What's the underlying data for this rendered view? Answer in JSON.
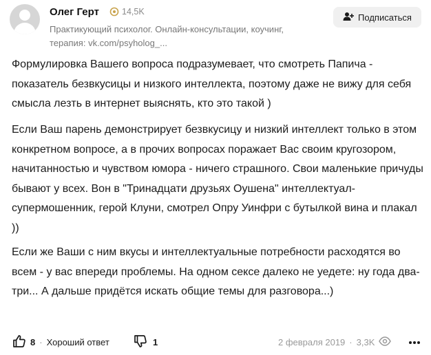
{
  "author": {
    "name": "Олег Герт",
    "karma": "14,5K",
    "bio": "Практикующий психолог. Онлайн-консультации, коучинг, терапия: vk.com/psyholog_..."
  },
  "subscribe_label": "Подписаться",
  "answer": {
    "paragraphs": [
      "Формулировка Вашего вопроса подразумевает, что смотреть Папича - показатель безвкусицы и низкого интеллекта, поэтому даже не вижу для себя смысла лезть в интернет выяснять, кто это такой )",
      "Если Ваш парень демонстрирует безвкусицу и низкий интеллект только в этом конкретном вопросе, а в прочих вопросах поражает Вас своим кругозором, начитанностью и чувством юмора - ничего страшного. Свои маленькие причуды бывают у всех. Вон в \"Тринадцати друзьях Оушена\" интеллектуал-супермошенник, герой Клуни, смотрел Опру Уинфри с бутылкой вина и плакал ))",
      "Если же Ваши с ним вкусы и интеллектуальные потребности расходятся во всем - у вас впереди проблемы. На одном сексе далеко не уедете: ну года два-три... А дальше придётся искать общие темы для разговора...)"
    ]
  },
  "footer": {
    "likes": "8",
    "separator": "·",
    "good_answer": "Хороший ответ",
    "dislikes": "1",
    "date": "2 февраля 2019",
    "views": "3,3K"
  },
  "icons": {
    "karma": "karma-icon",
    "subscribe": "add-user-icon",
    "like": "thumbs-up-icon",
    "dislike": "thumbs-down-icon",
    "views": "views-icon",
    "more": "more-icon"
  },
  "colors": {
    "karma_icon": "#c8a24b",
    "muted_text": "#777777",
    "button_bg": "#f0f0f0"
  }
}
